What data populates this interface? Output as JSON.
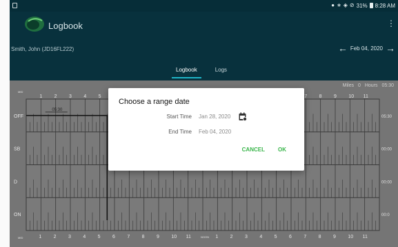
{
  "status_bar": {
    "icons": [
      "notification-icon",
      "location-icon",
      "bluetooth-icon",
      "wifi-icon",
      "dnd-icon"
    ],
    "battery": "31%",
    "time": "8:28 AM"
  },
  "app": {
    "title": "Logbook",
    "driver": "Smith, John (JD16FL222)",
    "date": "Feb 04, 2020",
    "tabs": [
      {
        "label": "Logbook",
        "active": true
      },
      {
        "label": "Logs",
        "active": false
      }
    ]
  },
  "grid": {
    "miles_label": "Miles",
    "miles_value": "0",
    "hours_label": "Hours",
    "hours_value": "05:30",
    "top_scale_label": "MID\nNIGHT",
    "top_hours": [
      "1",
      "2",
      "3",
      "4",
      "5",
      "6",
      "7",
      "8",
      "9",
      "10",
      "11",
      "",
      "1",
      "2",
      "3",
      "4",
      "5",
      "6",
      "7",
      "8",
      "9",
      "10",
      "11"
    ],
    "bottom_hours": [
      "1",
      "2",
      "3",
      "4",
      "5",
      "6",
      "7",
      "8",
      "9",
      "10",
      "11",
      "NOON",
      "1",
      "2",
      "3",
      "4",
      "5",
      "6",
      "7",
      "8",
      "9",
      "10",
      "11"
    ],
    "rows": [
      "OFF",
      "SB",
      "D",
      "ON"
    ],
    "totals": [
      "05:30",
      "00:00",
      "00:00",
      "00:0"
    ],
    "duty_label": "05:30",
    "off_until_hour": 5.5
  },
  "dialog": {
    "title": "Choose a range date",
    "start_label": "Start Time",
    "start_value": "Jan 28, 2020",
    "end_label": "End Time",
    "end_value": "Feb 04, 2020",
    "cancel": "CANCEL",
    "ok": "OK"
  },
  "colors": {
    "appbar": "#08313d",
    "grid_bg": "#757575",
    "accent": "#39b54a",
    "tab_indicator": "#1fb4c8"
  }
}
